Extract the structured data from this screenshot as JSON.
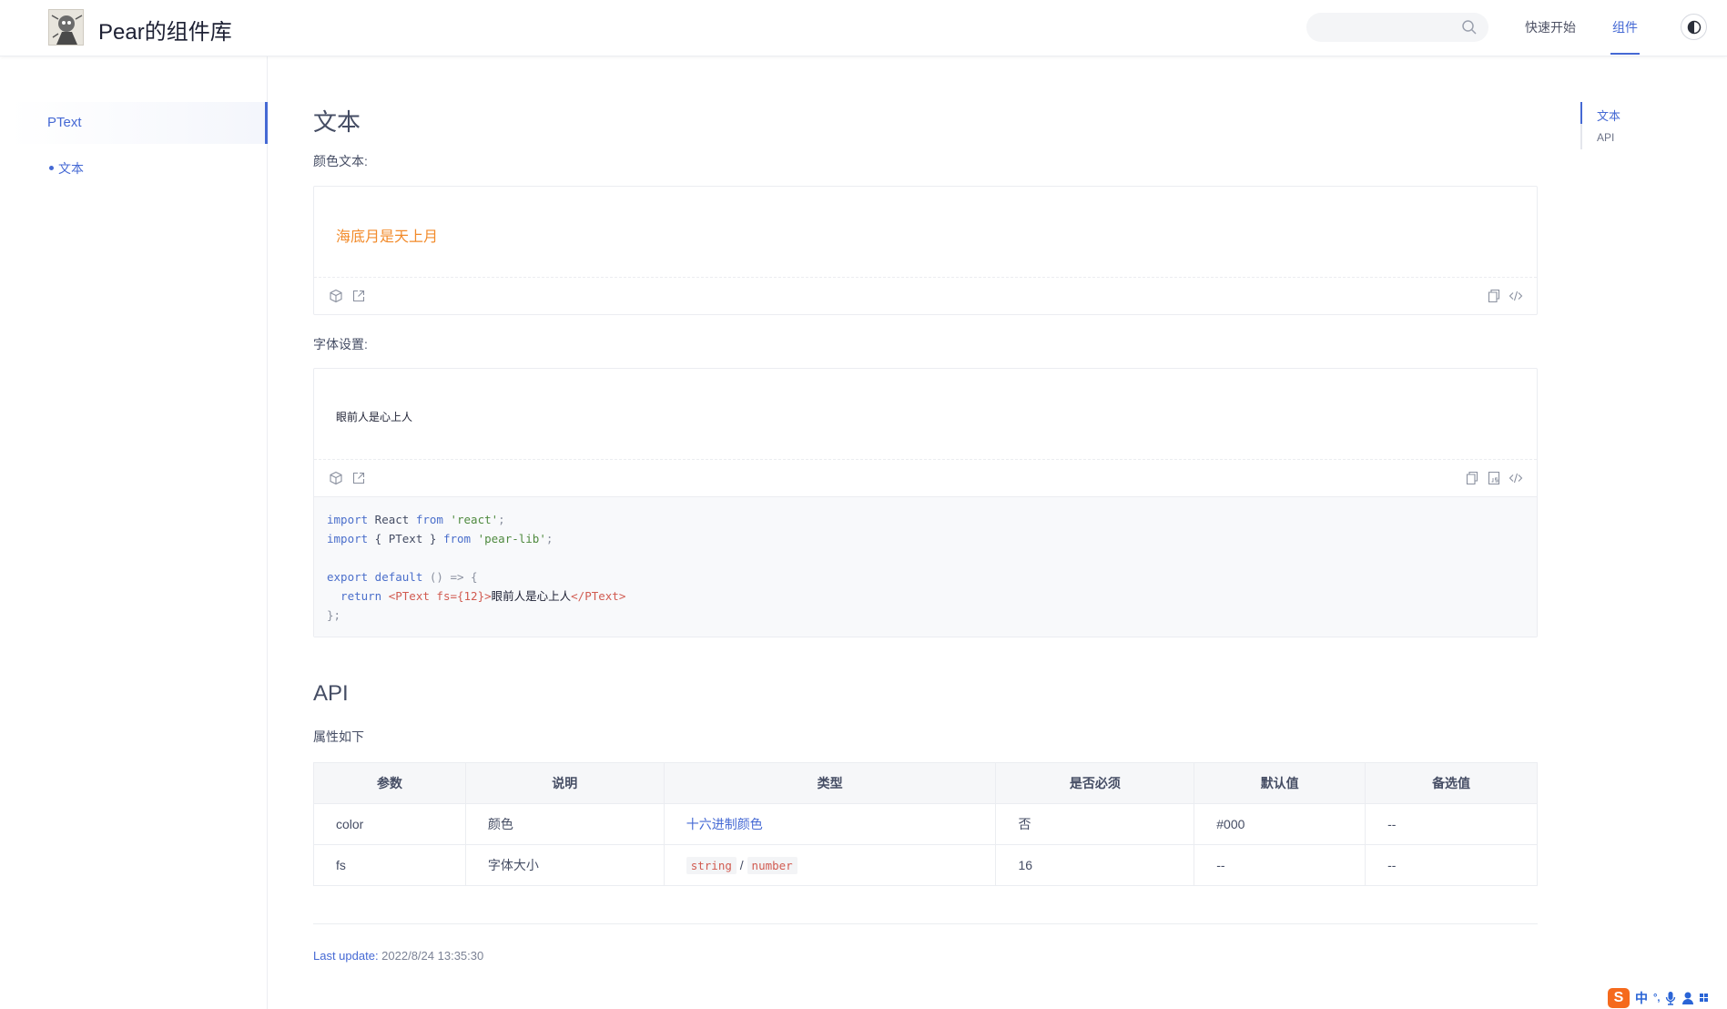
{
  "header": {
    "title": "Pear的组件库",
    "search_placeholder": "",
    "nav": {
      "quick_start": "快速开始",
      "components": "组件"
    }
  },
  "sidebar": {
    "group": "PText",
    "items": [
      {
        "label": "文本"
      }
    ]
  },
  "main": {
    "title": "文本",
    "demo1": {
      "label": "颜色文本:",
      "preview_text": "海底月是天上月"
    },
    "demo2": {
      "label": "字体设置:",
      "preview_text": "眼前人是心上人"
    },
    "code": {
      "line1": {
        "kw1": "import",
        "name": " React ",
        "kw2": "from",
        "str": " 'react'",
        "end": ";"
      },
      "line2": {
        "kw1": "import",
        "name": " { PText } ",
        "kw2": "from",
        "str": " 'pear-lib'",
        "end": ";"
      },
      "line4": {
        "kw1": "export default",
        "rest": " () => {"
      },
      "line5": {
        "kw": "  return ",
        "open_tag": "<PText ",
        "attr": "fs=",
        "val": "{12}",
        "close": ">",
        "text": "眼前人是心上人",
        "end_tag": "</PText>"
      },
      "line6": "};"
    },
    "api_title": "API",
    "api_desc": "属性如下",
    "table": {
      "headers": [
        "参数",
        "说明",
        "类型",
        "是否必须",
        "默认值",
        "备选值"
      ],
      "rows": [
        {
          "param": "color",
          "desc": "颜色",
          "type": "十六进制颜色",
          "required": "否",
          "default": "#000",
          "options": "--"
        },
        {
          "param": "fs",
          "desc": "字体大小",
          "type_a": "string",
          "type_sep": "/",
          "type_b": "number",
          "required": "16",
          "default": "--",
          "options": "--"
        }
      ]
    },
    "last_update_label": "Last update:",
    "last_update_value": " 2022/8/24 13:35:30"
  },
  "toc": {
    "items": [
      "文本",
      "API"
    ]
  },
  "ime": {
    "lang": "中",
    "punct": "°,"
  },
  "colors": {
    "accent": "#4569d4",
    "orange": "#f28b2b",
    "code_red": "#d15b51"
  }
}
